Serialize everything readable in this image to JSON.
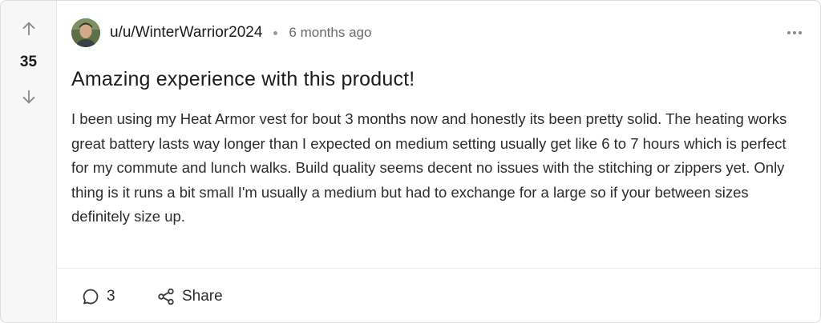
{
  "post": {
    "score": "35",
    "author": "u/u/WinterWarrior2024",
    "time": "6 months ago",
    "title": "Amazing experience with this product!",
    "body": "I been using my Heat Armor vest for bout 3 months now and honestly its been pretty solid. The heating works great battery lasts way longer than I expected on medium setting usually get like 6 to 7 hours which is perfect for my commute and lunch walks. Build quality seems decent no issues with the stitching or zippers yet. Only thing is it runs a bit small I'm usually a medium but had to exchange for a large so if your between sizes definitely size up."
  },
  "actions": {
    "comments_count": "3",
    "share_label": "Share"
  },
  "icons": {
    "upvote": "arrow-up-icon",
    "downvote": "arrow-down-icon",
    "more": "more-horizontal-icon",
    "comment": "comment-icon",
    "share": "share-icon"
  },
  "colors": {
    "vote_column_bg": "#f7f7f8",
    "text": "#1c1c1c",
    "muted": "#6a6a6a"
  }
}
